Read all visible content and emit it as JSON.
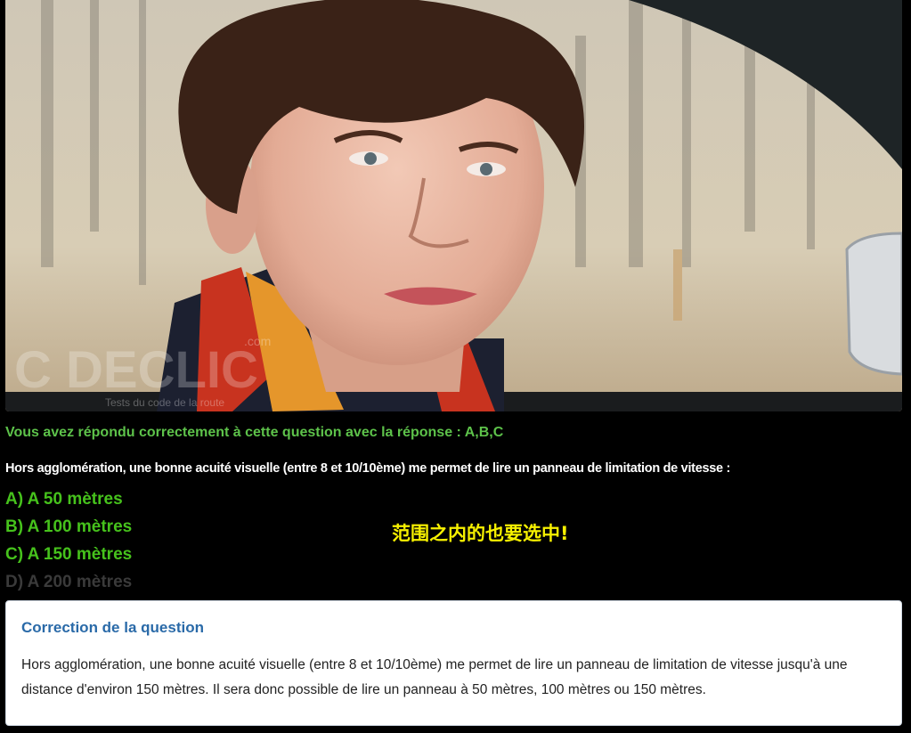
{
  "photo": {
    "watermark_brand": "C DECLIC",
    "watermark_suffix": ".com",
    "watermark_tagline": "Tests du code de la route"
  },
  "result_message": "Vous avez répondu correctement à cette question avec la réponse : A,B,C",
  "question": "Hors agglomération, une bonne acuité visuelle (entre 8 et 10/10ème) me permet de lire un panneau de limitation de vitesse :",
  "answers": [
    {
      "label": "A) A 50 mètres",
      "status": "correct"
    },
    {
      "label": "B) A 100 mètres",
      "status": "correct"
    },
    {
      "label": "C) A 150 mètres",
      "status": "correct"
    },
    {
      "label": "D) A 200 mètres",
      "status": "not-selected"
    }
  ],
  "annotation": "范围之内的也要选中!",
  "correction": {
    "title": "Correction de la question",
    "text": "Hors agglomération, une bonne acuité visuelle (entre 8 et 10/10ème) me permet de lire un panneau de limitation de vitesse jusqu'à une distance d'environ 150 mètres. Il sera donc possible de lire un panneau à 50 mètres, 100 mètres ou 150 mètres."
  },
  "colors": {
    "correct_answer": "#46c21c",
    "result_message": "#5dc24a",
    "annotation": "#f6f000",
    "panel_title": "#2a6aa8"
  }
}
